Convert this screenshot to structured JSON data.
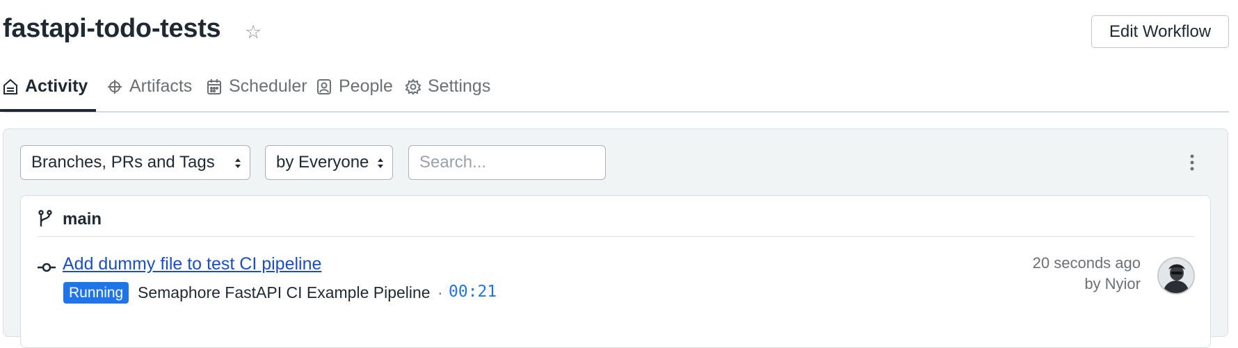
{
  "header": {
    "title": "fastapi-todo-tests",
    "star_icon": "star-outline-icon",
    "edit_button_label": "Edit Workflow"
  },
  "tabs": [
    {
      "label": "Activity",
      "icon": "home-icon",
      "active": true
    },
    {
      "label": "Artifacts",
      "icon": "artifacts-icon",
      "active": false
    },
    {
      "label": "Scheduler",
      "icon": "calendar-icon",
      "active": false
    },
    {
      "label": "People",
      "icon": "person-icon",
      "active": false
    },
    {
      "label": "Settings",
      "icon": "gear-icon",
      "active": false
    }
  ],
  "filters": {
    "scope_select": "Branches, PRs and Tags",
    "author_select": "by Everyone",
    "search_placeholder": "Search..."
  },
  "branch": {
    "name": "main",
    "icon": "branch-icon"
  },
  "workflow": {
    "commit_message": "Add dummy file to test CI pipeline",
    "status": "Running",
    "pipeline_name": "Semaphore FastAPI CI Example Pipeline",
    "separator": "·",
    "duration": "00:21",
    "time_ago": "20 seconds ago",
    "author": "by Nyior"
  },
  "colors": {
    "status_running": "#1f74ea",
    "link": "#1a4fc4",
    "panel_bg": "#f0f4f5"
  }
}
